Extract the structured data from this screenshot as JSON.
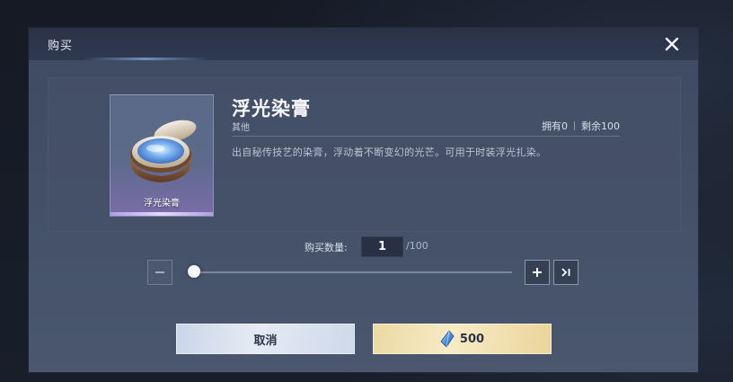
{
  "dialog": {
    "title": "购买",
    "close_icon": "close-icon"
  },
  "item": {
    "name": "浮光染膏",
    "category": "其他",
    "card_label": "浮光染膏",
    "owned": "拥有0",
    "remaining": "剩余100",
    "description": "出自秘传技艺的染膏，浮动着不断变幻的光芒。可用于时装浮光扎染。"
  },
  "quantity": {
    "label": "购买数量:",
    "value": "1",
    "max_text": "/100",
    "slider_fraction": 0.01
  },
  "buttons": {
    "cancel": "取消",
    "buy_price": "500",
    "currency_icon": "crystal-gem-icon"
  },
  "colors": {
    "cancel_button": "#dde5f1",
    "buy_button": "#f3e4b6",
    "dialog_bg": "#445169",
    "titlebar_bg": "#2c3549"
  }
}
